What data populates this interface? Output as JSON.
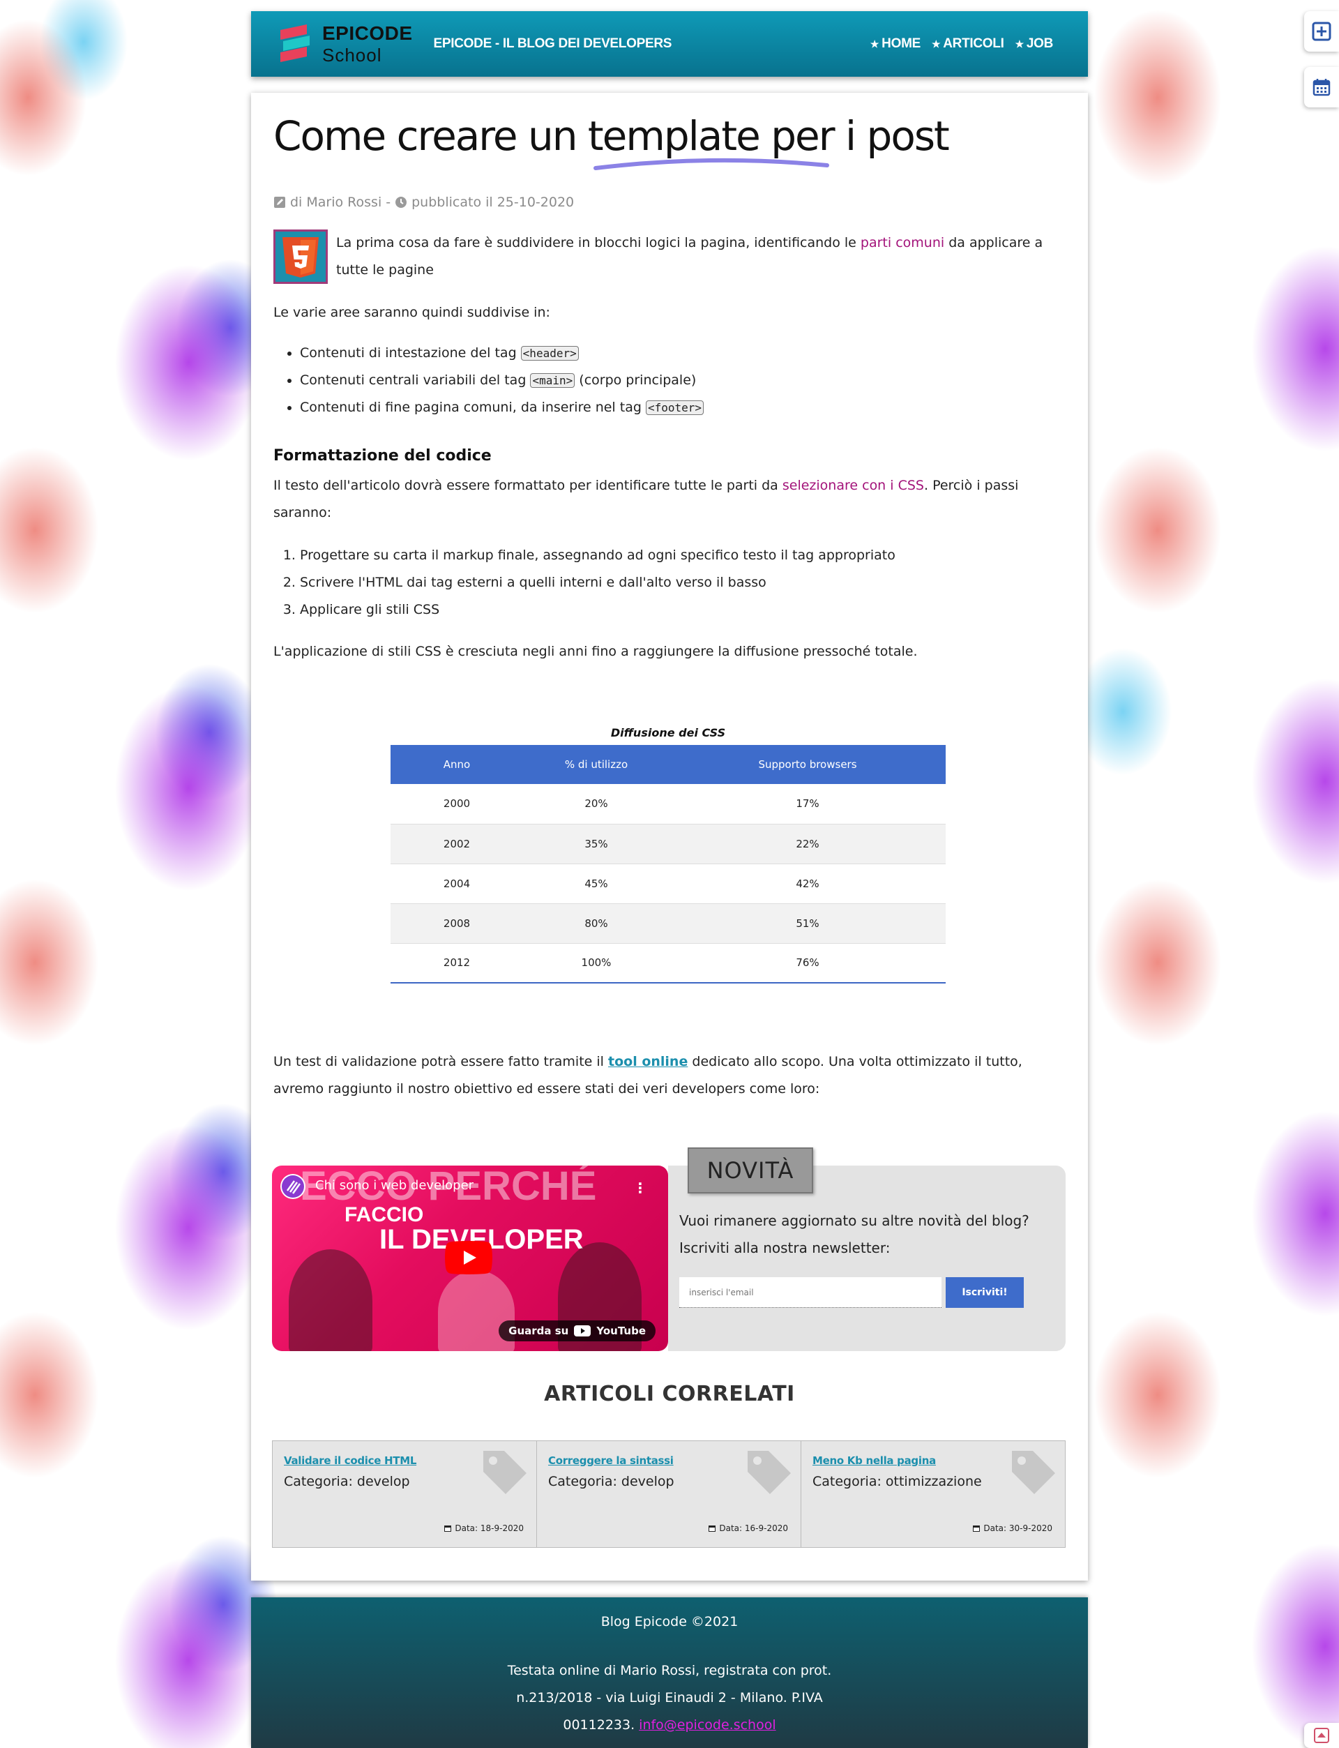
{
  "header": {
    "logo_title": "EPICODE",
    "logo_sub": "School",
    "blog_name": "EPICODE - IL BLOG DEI DEVELOPERS",
    "nav": [
      "HOME",
      "ARTICOLI",
      "JOB"
    ]
  },
  "article": {
    "title": "Come creare un template per i post",
    "meta_author": "di Mario Rossi -",
    "meta_date": "pubblicato il 25-10-2020",
    "intro_before": "La prima cosa da fare è suddividere in blocchi logici la pagina, identificando le",
    "intro_link": "parti comuni",
    "intro_after": "da applicare a tutte le pagine",
    "areas_intro": "Le varie aree saranno quindi suddivise in:",
    "areas": [
      {
        "text": "Contenuti di intestazione del tag",
        "tag": "<header>",
        "after": ""
      },
      {
        "text": "Contenuti centrali variabili del tag",
        "tag": "<main>",
        "after": "(corpo principale)"
      },
      {
        "text": "Contenuti di fine pagina comuni, da inserire nel tag",
        "tag": "<footer>",
        "after": ""
      }
    ],
    "format_heading": "Formattazione del codice",
    "format_before": "Il testo dell'articolo dovrà essere formattato per identificare tutte le parti da",
    "format_link": "selezionare con i CSS",
    "format_after": ". Perciò i passi saranno:",
    "steps": [
      "Progettare su carta il markup finale, assegnando ad ogni specifico testo il tag appropriato",
      "Scrivere l'HTML dai tag esterni a quelli interni e dall'alto verso il basso",
      "Applicare gli stili CSS"
    ],
    "css_growth": "L'applicazione di stili CSS è cresciuta negli anni fino a raggiungere la diffusione pressoché totale.",
    "validation_before": "Un test di validazione potrà essere fatto tramite il",
    "validation_link": "tool online",
    "validation_after": "dedicato allo scopo. Una volta ottimizzato il tutto, avremo raggiunto il nostro obiettivo ed essere stati dei veri developers come loro:"
  },
  "table": {
    "caption": "Diffusione dei CSS",
    "headers": [
      "Anno",
      "% di utilizzo",
      "Supporto browsers"
    ],
    "rows": [
      [
        "2000",
        "20%",
        "17%"
      ],
      [
        "2002",
        "35%",
        "22%"
      ],
      [
        "2004",
        "45%",
        "42%"
      ],
      [
        "2008",
        "80%",
        "51%"
      ],
      [
        "2012",
        "100%",
        "76%"
      ]
    ]
  },
  "video": {
    "channel_title": "Chi sono i web developer",
    "overlay_line1": "ECCO PERCHÉ",
    "overlay_line2": "FACCIO",
    "overlay_line3": "IL DEVELOPER",
    "watch_on": "Guarda su",
    "youtube": "YouTube"
  },
  "newsletter": {
    "badge": "NOVITÀ",
    "text": "Vuoi rimanere aggiornato su altre novità del blog? Iscriviti alla nostra newsletter:",
    "placeholder": "inserisci l'email",
    "button": "Iscriviti!"
  },
  "related": {
    "title": "ARTICOLI CORRELATI",
    "items": [
      {
        "link": "Validare il codice HTML",
        "category": "Categoria: develop",
        "date": "Data: 18-9-2020"
      },
      {
        "link": "Correggere la sintassi",
        "category": "Categoria: develop",
        "date": "Data: 16-9-2020"
      },
      {
        "link": "Meno Kb nella pagina",
        "category": "Categoria: ottimizzazione",
        "date": "Data: 30-9-2020"
      }
    ]
  },
  "footer": {
    "copyright": "Blog Epicode ©2021",
    "legal": "Testata online di Mario Rossi, registrata con prot. n.213/2018 - via Luigi Einaudi 2 - Milano. P.IVA 00112233.",
    "email": "info@epicode.school"
  },
  "colors": {
    "header_teal": "#0f9ab7",
    "accent_magenta": "#a3137a",
    "table_blue": "#3e6ccb",
    "link_teal": "#1c8fad",
    "footer_dark": "#1f3a44"
  }
}
